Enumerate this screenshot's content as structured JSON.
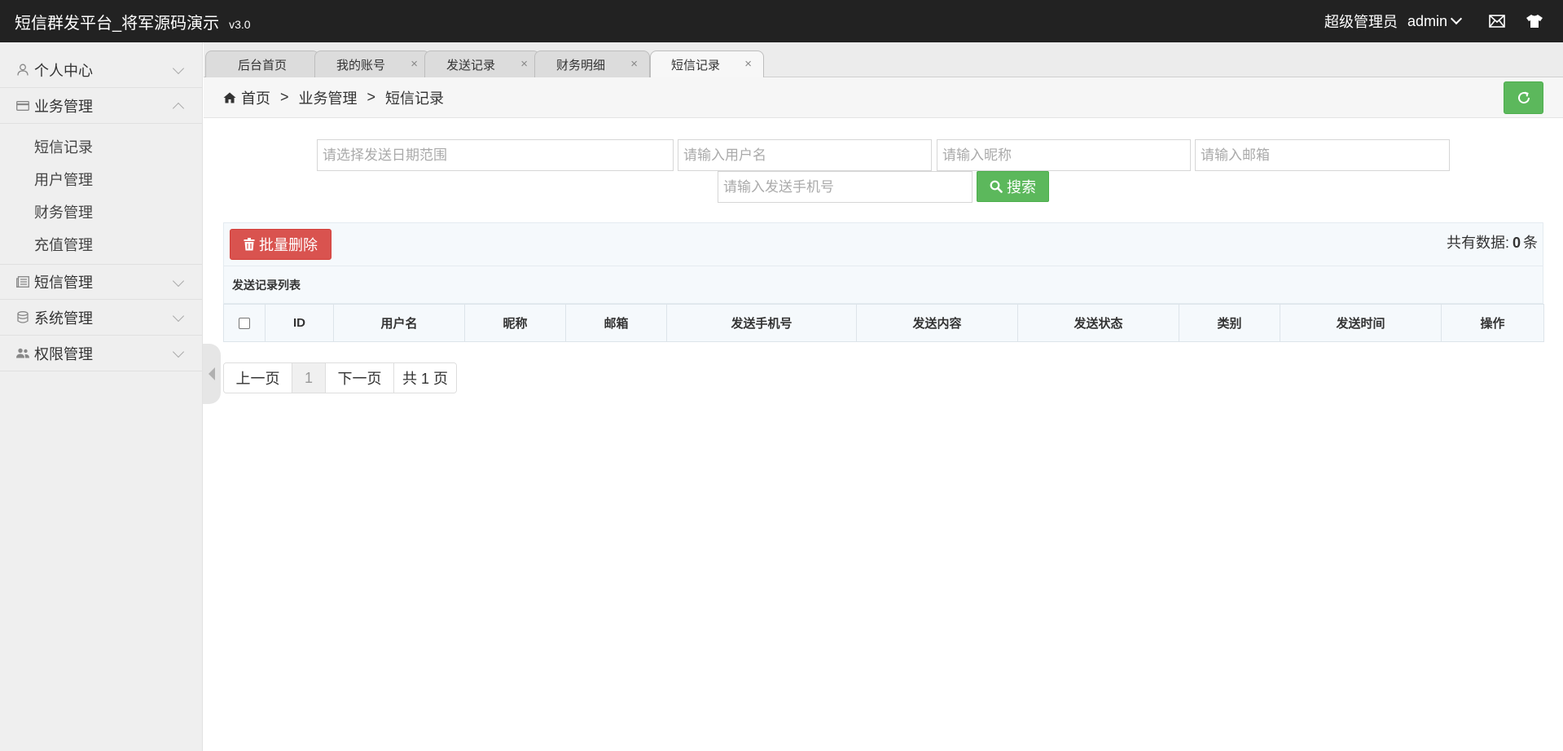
{
  "header": {
    "title": "短信群发平台_将军源码演示",
    "version": "v3.0",
    "user_role": "超级管理员",
    "user_name": "admin"
  },
  "sidebar": {
    "groups": [
      {
        "label": "个人中心",
        "icon": "user-icon",
        "expanded": false
      },
      {
        "label": "业务管理",
        "icon": "card-icon",
        "expanded": true
      },
      {
        "label": "短信管理",
        "icon": "newspaper-icon",
        "expanded": false
      },
      {
        "label": "系统管理",
        "icon": "database-icon",
        "expanded": false
      },
      {
        "label": "权限管理",
        "icon": "users-icon",
        "expanded": false
      }
    ],
    "business_items": [
      "短信记录",
      "用户管理",
      "财务管理",
      "充值管理"
    ]
  },
  "tabs": [
    {
      "label": "后台首页",
      "closable": false
    },
    {
      "label": "我的账号",
      "closable": true
    },
    {
      "label": "发送记录",
      "closable": true
    },
    {
      "label": "财务明细",
      "closable": true
    },
    {
      "label": "短信记录",
      "closable": true,
      "active": true
    }
  ],
  "tab_close_glyph": "×",
  "breadcrumb": {
    "items": [
      "首页",
      "业务管理",
      "短信记录"
    ],
    "separator": ">"
  },
  "search": {
    "date_range_placeholder": "请选择发送日期范围",
    "username_placeholder": "请输入用户名",
    "nickname_placeholder": "请输入昵称",
    "email_placeholder": "请输入邮箱",
    "phone_placeholder": "请输入发送手机号",
    "button_label": "搜索"
  },
  "toolbar": {
    "bulk_delete_label": "批量删除",
    "total_prefix": "共有数据:",
    "total_count": "0",
    "total_suffix": "条"
  },
  "table": {
    "caption": "发送记录列表",
    "columns": [
      "ID",
      "用户名",
      "昵称",
      "邮箱",
      "发送手机号",
      "发送内容",
      "发送状态",
      "类别",
      "发送时间",
      "操作"
    ]
  },
  "pagination": {
    "prev": "上一页",
    "current": "1",
    "next": "下一页",
    "total": "共 1 页"
  },
  "colors": {
    "topbar": "#222222",
    "success": "#5cb85c",
    "danger": "#d9534f"
  }
}
